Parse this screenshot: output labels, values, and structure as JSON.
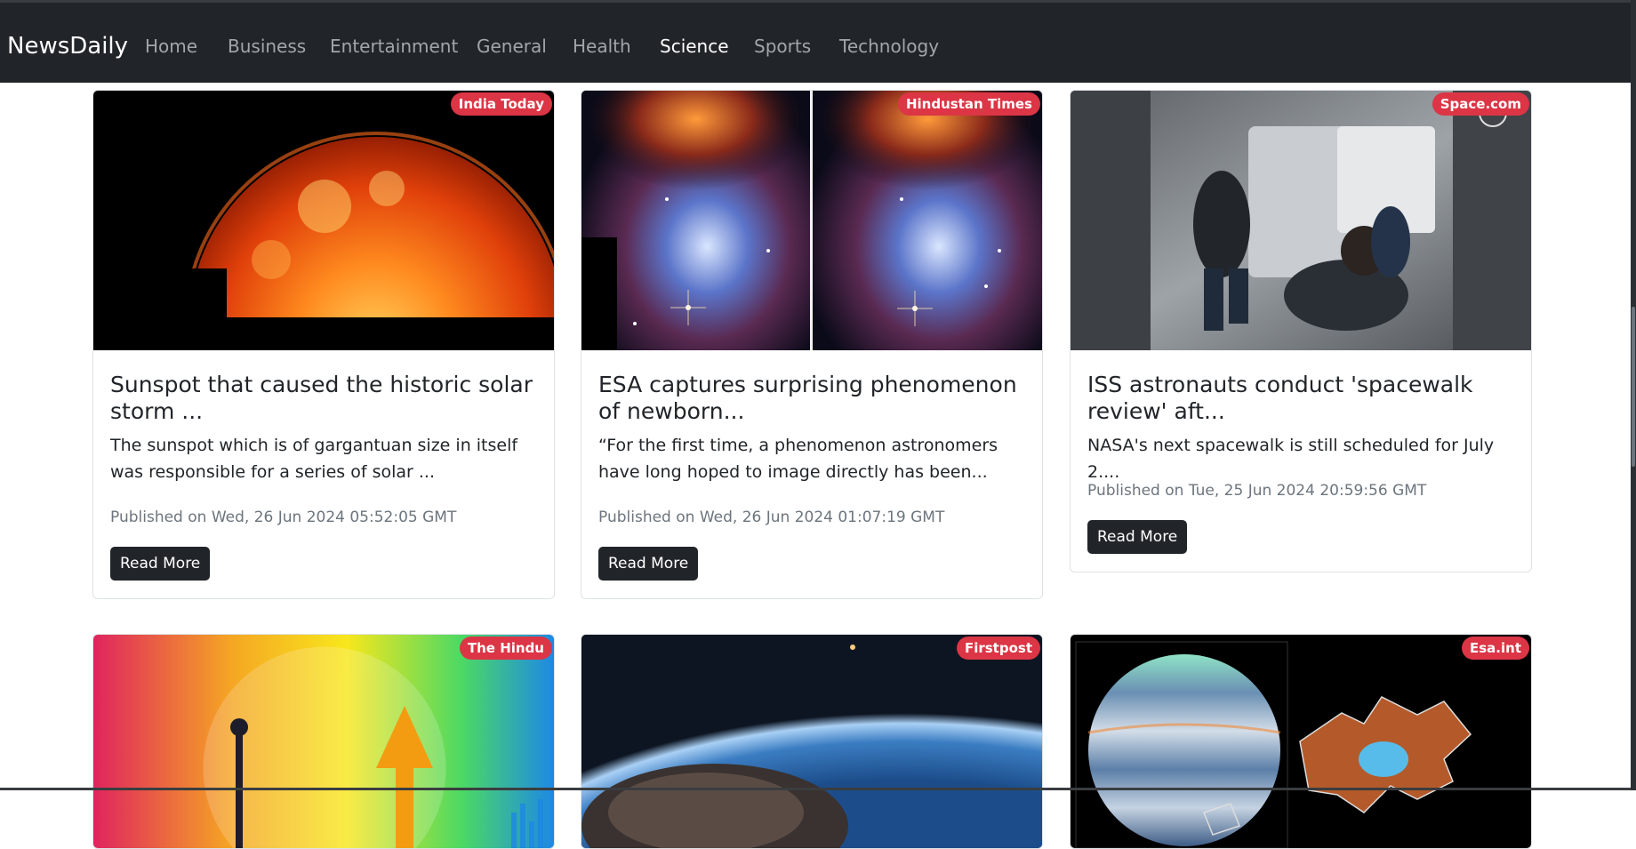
{
  "nav": {
    "brand": "NewsDaily",
    "links": [
      "Home",
      "Business",
      "Entertainment",
      "General",
      "Health",
      "Science",
      "Sports",
      "Technology"
    ],
    "active": "Science"
  },
  "cards": [
    {
      "source": "India Today",
      "title": "Sunspot that caused the historic solar storm ...",
      "description": "The sunspot which is of gargantuan size in itself was responsible for a series of solar ...",
      "published": "Published on Wed, 26 Jun 2024 05:52:05 GMT",
      "button": "Read More"
    },
    {
      "source": "Hindustan Times",
      "title": "ESA captures surprising phenomenon of newborn...",
      "description": "“For the first time, a phenomenon astronomers have long hoped to image directly has been...",
      "published": "Published on Wed, 26 Jun 2024 01:07:19 GMT",
      "button": "Read More"
    },
    {
      "source": "Space.com",
      "title": "ISS astronauts conduct 'spacewalk review' aft...",
      "description": "NASA's next spacewalk is still scheduled for July 2....",
      "published": "Published on Tue, 25 Jun 2024 20:59:56 GMT",
      "button": "Read More"
    },
    {
      "source": "The Hindu"
    },
    {
      "source": "Firstpost"
    },
    {
      "source": "Esa.int"
    }
  ],
  "colors": {
    "navbar": "#212529",
    "badge": "#dc3545",
    "button": "#212529"
  }
}
